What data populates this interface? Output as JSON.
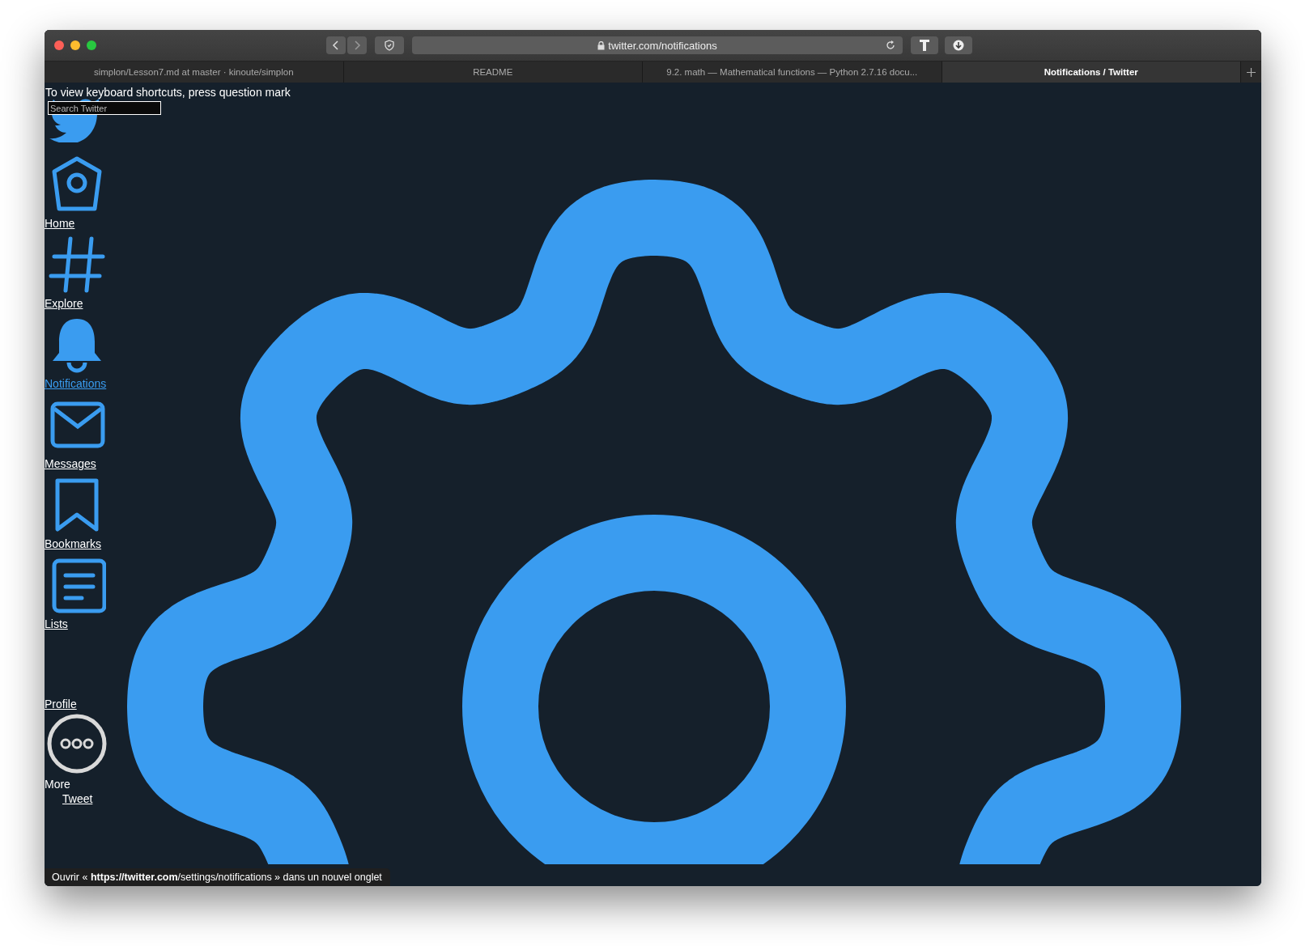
{
  "browser": {
    "url": "twitter.com/notifications",
    "tabs": [
      {
        "label": "simplon/Lesson7.md at master · kinoute/simplon",
        "selected": false
      },
      {
        "label": "README",
        "selected": false
      },
      {
        "label": "9.2. math — Mathematical functions — Python 2.7.16 docu...",
        "selected": false
      },
      {
        "label": "Notifications / Twitter",
        "selected": true
      }
    ]
  },
  "page": {
    "keyboard_hint": "To view keyboard shortcuts, press question mark",
    "search": {
      "placeholder": "Search Twitter"
    },
    "nav": [
      {
        "label": "Home",
        "kind": "link",
        "selected": false
      },
      {
        "label": "Explore",
        "kind": "link",
        "selected": false
      },
      {
        "label": "Notifications",
        "kind": "link",
        "selected": true
      },
      {
        "label": "Messages",
        "kind": "link",
        "selected": false
      },
      {
        "label": "Bookmarks",
        "kind": "link",
        "selected": false
      },
      {
        "label": "Lists",
        "kind": "link",
        "selected": false
      },
      {
        "label": "Profile",
        "kind": "link",
        "selected": false
      },
      {
        "label": "More",
        "kind": "plain",
        "selected": false
      },
      {
        "label": "Tweet",
        "kind": "tweet",
        "selected": false
      }
    ],
    "status_tooltip": "Ouvrir « **https://twitter.com**/settings/notifications » dans un nouvel onglet"
  }
}
